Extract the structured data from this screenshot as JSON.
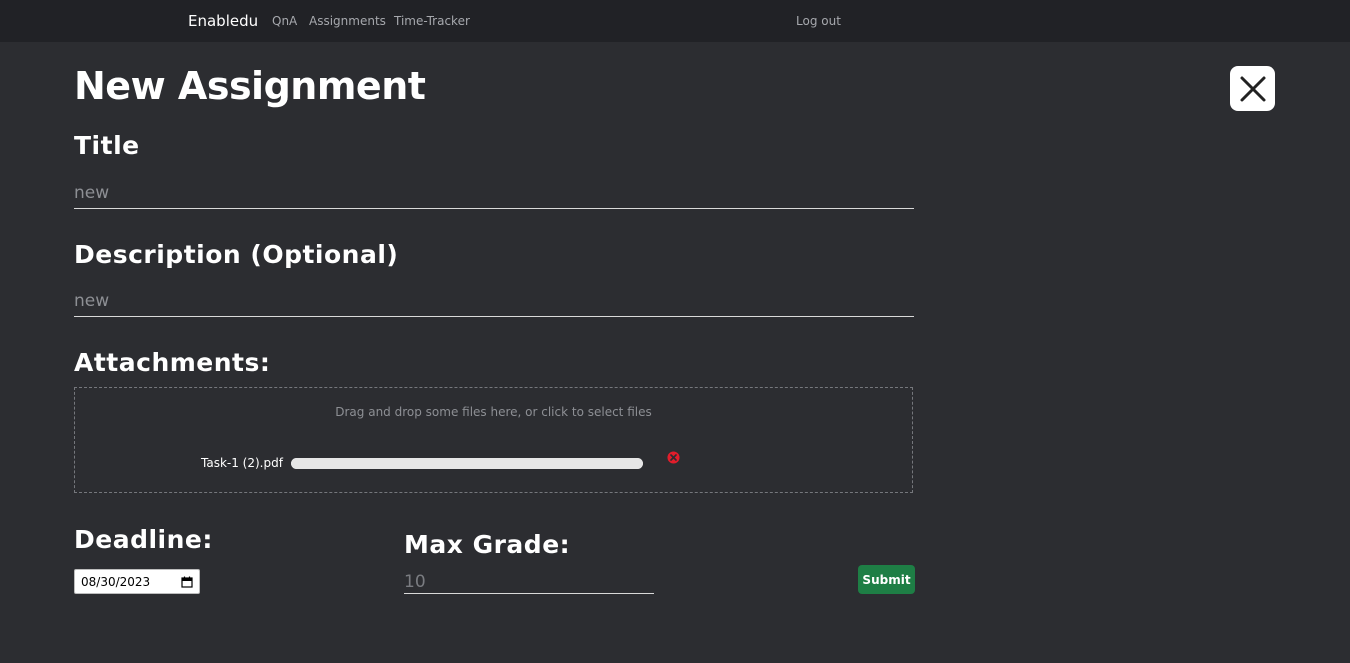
{
  "nav": {
    "brand": "Enabledu",
    "links": [
      "QnA",
      "Assignments",
      "Time-Tracker"
    ],
    "logout": "Log out"
  },
  "page": {
    "title": "New Assignment",
    "close_icon": "close-icon"
  },
  "form": {
    "title_label": "Title",
    "title_value": "new",
    "description_label": "Description (Optional)",
    "description_value": "new",
    "attachments_label": "Attachments:",
    "dropzone_hint": "Drag and drop some files here, or click to select files",
    "files": [
      {
        "name": "Task-1 (2).pdf",
        "progress_percent": 100
      }
    ],
    "deadline_label": "Deadline:",
    "deadline_value": "08/30/2023",
    "max_grade_label": "Max Grade:",
    "max_grade_placeholder": "10",
    "submit_label": "Submit"
  },
  "colors": {
    "background": "#2c2d31",
    "navbar": "#212226",
    "submit": "#1e7e45",
    "remove": "#e11d2b"
  }
}
